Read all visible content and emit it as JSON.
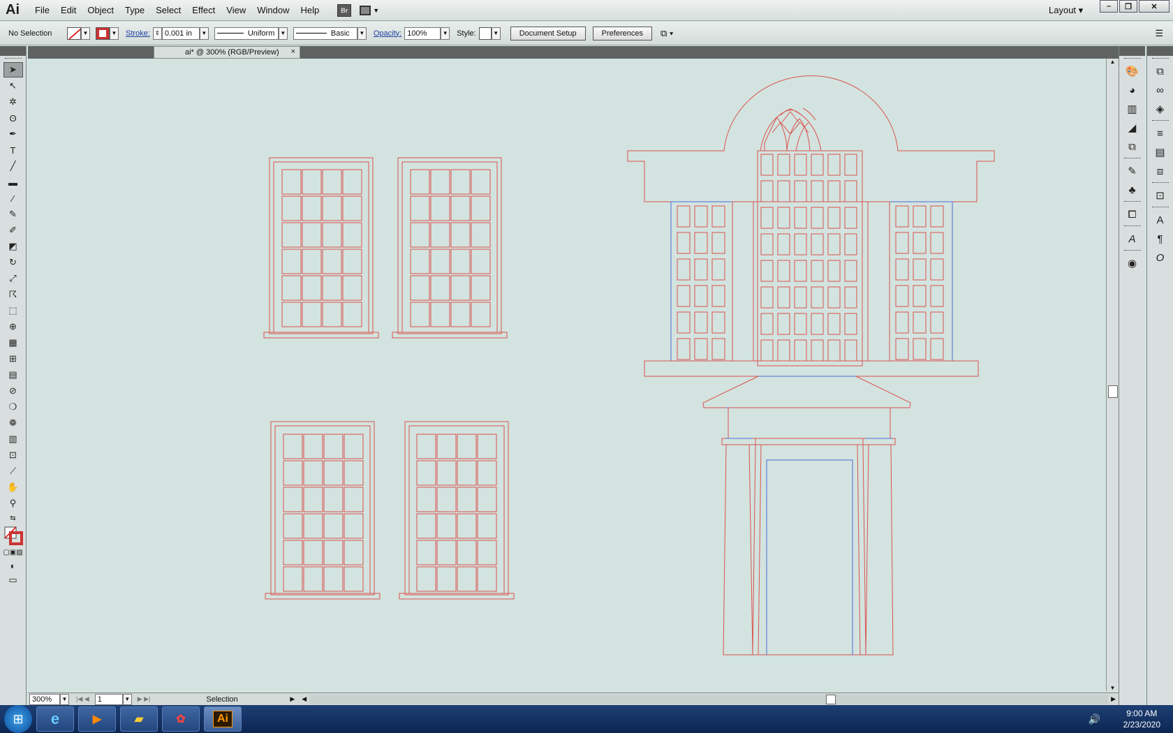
{
  "app": {
    "logo": "Ai",
    "layout_label": "Layout"
  },
  "menu": [
    "File",
    "Edit",
    "Object",
    "Type",
    "Select",
    "Effect",
    "View",
    "Window",
    "Help"
  ],
  "bridge_label": "Br",
  "window_controls": {
    "minimize": "–",
    "restore": "❐",
    "close": "✕"
  },
  "control_bar": {
    "selection_state": "No Selection",
    "stroke_label": "Stroke:",
    "stroke_value": "0.001 in",
    "profile": "Uniform",
    "brush": "Basic",
    "opacity_label": "Opacity:",
    "opacity_value": "100%",
    "style_label": "Style:",
    "document_setup": "Document Setup",
    "preferences": "Preferences"
  },
  "document_tab": {
    "title": "ai* @ 300% (RGB/Preview)",
    "close": "×"
  },
  "status": {
    "zoom": "300%",
    "page": "1",
    "tool": "Selection"
  },
  "taskbar": {
    "time": "9:00 AM",
    "date": "2/23/2020",
    "ai_label": "Ai"
  },
  "colors": {
    "canvas": "#d3e3df",
    "stroke_red": "#d9534f",
    "stroke_blue": "#4a6bd8",
    "taskbar": "#0d2653"
  },
  "tools": [
    "selection-tool",
    "direct-selection-tool",
    "magic-wand-tool",
    "lasso-tool",
    "pen-tool",
    "type-tool",
    "line-tool",
    "rectangle-tool",
    "paintbrush-tool",
    "pencil-tool",
    "blob-brush-tool",
    "eraser-tool",
    "rotate-tool",
    "scale-tool",
    "warp-tool",
    "free-transform-tool",
    "shape-builder-tool",
    "perspective-grid-tool",
    "mesh-tool",
    "gradient-tool",
    "eyedropper-tool",
    "blend-tool",
    "symbol-sprayer-tool",
    "graph-tool",
    "artboard-tool",
    "slice-tool",
    "hand-tool",
    "zoom-tool"
  ]
}
